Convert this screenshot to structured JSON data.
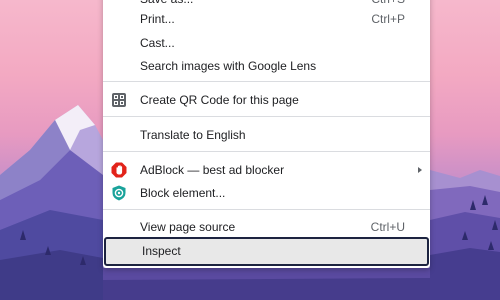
{
  "menu": {
    "items": {
      "save_as": {
        "label": "Save as...",
        "shortcut": "Ctrl+S"
      },
      "print": {
        "label": "Print...",
        "shortcut": "Ctrl+P"
      },
      "cast": {
        "label": "Cast..."
      },
      "search_lens": {
        "label": "Search images with Google Lens"
      },
      "qr": {
        "label": "Create QR Code for this page",
        "icon": "qr-code-icon"
      },
      "translate": {
        "label": "Translate to English"
      },
      "adblock": {
        "label": "AdBlock — best ad blocker",
        "icon": "adblock-hand-icon"
      },
      "block_element": {
        "label": "Block element...",
        "icon": "adblock-shield-icon"
      },
      "view_source": {
        "label": "View page source",
        "shortcut": "Ctrl+U"
      },
      "inspect": {
        "label": "Inspect"
      }
    }
  },
  "colors": {
    "adblock_red": "#e2231a",
    "adblock_teal": "#1aa39b",
    "highlight_border": "#1c2340"
  }
}
